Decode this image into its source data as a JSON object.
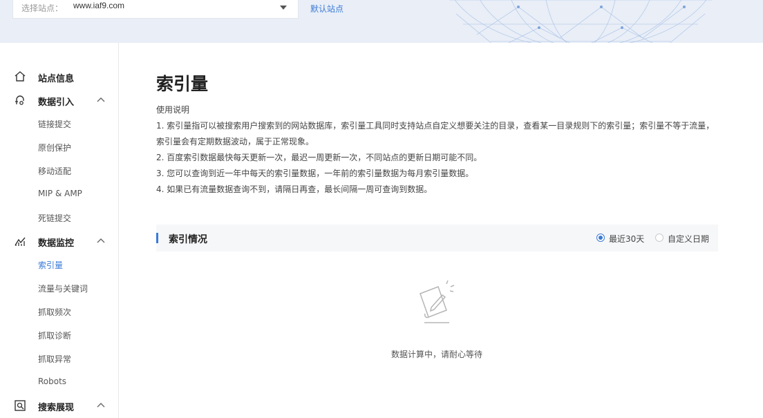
{
  "top": {
    "site_select_label": "选择站点：",
    "site_value": "www.iaf9.com",
    "default_site_link": "默认站点"
  },
  "sidebar": {
    "site_info": "站点信息",
    "groups": [
      {
        "label": "数据引入",
        "items": [
          "链接提交",
          "原创保护",
          "移动适配",
          "MIP & AMP",
          "死链提交"
        ]
      },
      {
        "label": "数据监控",
        "items": [
          "索引量",
          "流量与关键词",
          "抓取频次",
          "抓取诊断",
          "抓取异常",
          "Robots"
        ],
        "active_item": "索引量"
      },
      {
        "label": "搜索展现",
        "items": []
      }
    ]
  },
  "main": {
    "title": "索引量",
    "usage_heading": "使用说明",
    "usage_lines": [
      "1. 索引量指可以被搜索用户搜索到的网站数据库，索引量工具同时支持站点自定义想要关注的目录，查看某一目录规则下的索引量；索引量不等于流量，",
      "索引量会有定期数据波动，属于正常现象。",
      "2. 百度索引数据最快每天更新一次，最迟一周更新一次，不同站点的更新日期可能不同。",
      "3. 您可以查询到近一年中每天的索引量数据，一年前的索引量数据为每月索引量数据。",
      "4. 如果已有流量数据查询不到，请隔日再查，最长间隔一周可查询到数据。"
    ],
    "index_section": {
      "title": "索引情况",
      "radio_options": [
        "最近30天",
        "自定义日期"
      ],
      "selected": "最近30天"
    },
    "empty_state_text": "数据计算中，请耐心等待"
  },
  "colors": {
    "accent": "#3b7bd6",
    "banner_bg": "#e9eef7"
  },
  "icons": {
    "site_info": "home-icon",
    "data_import": "import-icon",
    "data_monitor": "chart-icon",
    "search_display": "search-display-icon",
    "empty_state": "document-pen-icon"
  }
}
